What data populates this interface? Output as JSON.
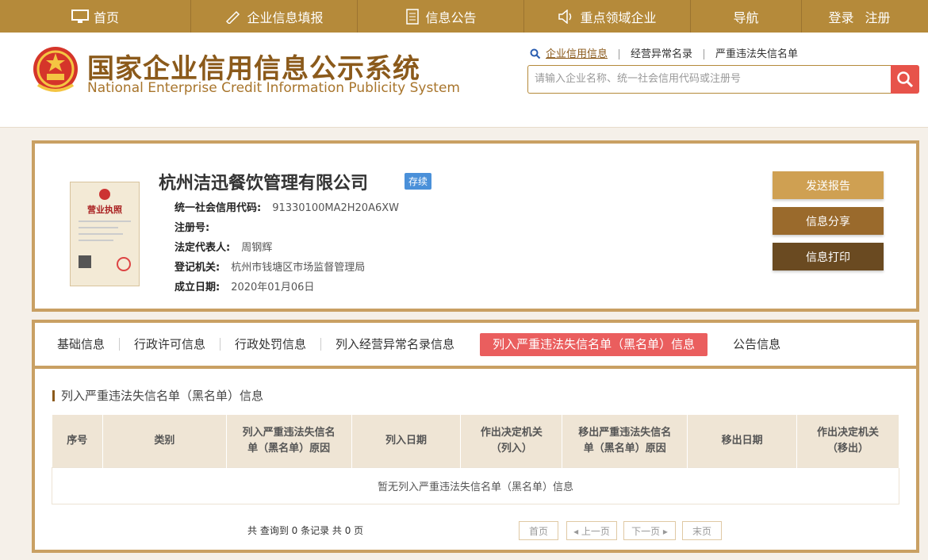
{
  "topnav": {
    "items": [
      {
        "label": "首页",
        "icon": "monitor-icon"
      },
      {
        "label": "企业信息填报",
        "icon": "pen-icon"
      },
      {
        "label": "信息公告",
        "icon": "document-icon"
      },
      {
        "label": "重点领域企业",
        "icon": "speaker-icon"
      },
      {
        "label": "导航",
        "icon": ""
      }
    ],
    "login": "登录",
    "register": "注册"
  },
  "header": {
    "title_cn": "国家企业信用信息公示系统",
    "title_en": "National Enterprise Credit Information Publicity System",
    "search_links": [
      "企业信用信息",
      "经营异常名录",
      "严重违法失信名单"
    ],
    "search_placeholder": "请输入企业名称、统一社会信用代码或注册号"
  },
  "company": {
    "name": "杭州洁迅餐饮管理有限公司",
    "status": "存续",
    "license_title": "营业执照",
    "fields": [
      {
        "label": "统一社会信用代码:",
        "value": "91330100MA2H20A6XW"
      },
      {
        "label": "注册号:",
        "value": ""
      },
      {
        "label": "法定代表人:",
        "value": "周钢辉"
      },
      {
        "label": "登记机关:",
        "value": "杭州市钱塘区市场监督管理局"
      },
      {
        "label": "成立日期:",
        "value": "2020年01月06日"
      }
    ],
    "buttons": [
      "发送报告",
      "信息分享",
      "信息打印"
    ]
  },
  "tabs": [
    "基础信息",
    "行政许可信息",
    "行政处罚信息",
    "列入经营异常名录信息",
    "列入严重违法失信名单（黑名单）信息",
    "公告信息"
  ],
  "section": {
    "title": "列入严重违法失信名单（黑名单）信息",
    "columns": [
      "序号",
      "类别",
      "列入严重违法失信名单（黑名单）原因",
      "列入日期",
      "作出决定机关（列入）",
      "移出严重违法失信名单（黑名单）原因",
      "移出日期",
      "作出决定机关（移出）"
    ],
    "empty_text": "暂无列入严重违法失信名单（黑名单）信息",
    "count_text": "共 查询到 0 条记录 共 0 页"
  },
  "pager": {
    "first": "首页",
    "prev": "◂ 上一页",
    "next": "下一页 ▸",
    "last": "末页"
  },
  "colors": {
    "gold": "#b58a3a",
    "accent_red": "#ea5e5e",
    "status_blue": "#4a90d9"
  }
}
